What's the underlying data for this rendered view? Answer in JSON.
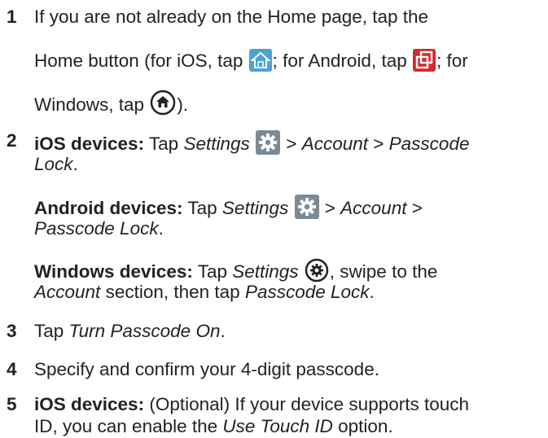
{
  "steps": [
    {
      "number": "1",
      "line1": "If you are not already on the Home page, tap the",
      "line2_a": "Home button (for iOS, tap ",
      "line2_b": "; for Android, tap ",
      "line2_c": "; for",
      "line3_a": "Windows, tap ",
      "line3_b": ")."
    },
    {
      "number": "2",
      "ios_label": "iOS devices:",
      "ios_tap": " Tap ",
      "ios_settings": "Settings",
      "ios_sep1": " > ",
      "ios_account": "Account",
      "ios_sep2": " > ",
      "ios_passcode1": "Passcode",
      "ios_passcode2": "Lock",
      "ios_end": ".",
      "android_label": "Android devices:",
      "android_tap": " Tap ",
      "android_settings": "Settings",
      "android_sep1": " > ",
      "android_account": "Account",
      "android_sep2": " >",
      "android_passcode": "Passcode Lock",
      "android_end": ".",
      "windows_label": "Windows devices:",
      "windows_tap": " Tap ",
      "windows_settings": "Settings",
      "windows_after": ", swipe to the",
      "windows_account": "Account",
      "windows_mid": " section, then tap ",
      "windows_passcode": "Passcode Lock",
      "windows_end": "."
    },
    {
      "number": "3",
      "text_a": "Tap ",
      "text_em": "Turn Passcode On",
      "text_b": "."
    },
    {
      "number": "4",
      "text": "Specify and confirm your 4-digit passcode."
    },
    {
      "number": "5",
      "label": "iOS devices:",
      "text_a": " (Optional) If your device supports touch",
      "text_b": "ID, you can enable the ",
      "text_em": "Use Touch ID",
      "text_c": " option."
    }
  ],
  "icons": {
    "ios_home": "ios-home-icon",
    "android_home": "android-home-icon",
    "windows_home": "windows-home-icon",
    "settings_gear": "settings-gear-icon",
    "windows_settings": "windows-settings-icon"
  },
  "colors": {
    "text": "#222222",
    "ios_icon": "#4aa3d6",
    "android_icon": "#d42a2a",
    "gear_bg": "#7c8a96"
  }
}
